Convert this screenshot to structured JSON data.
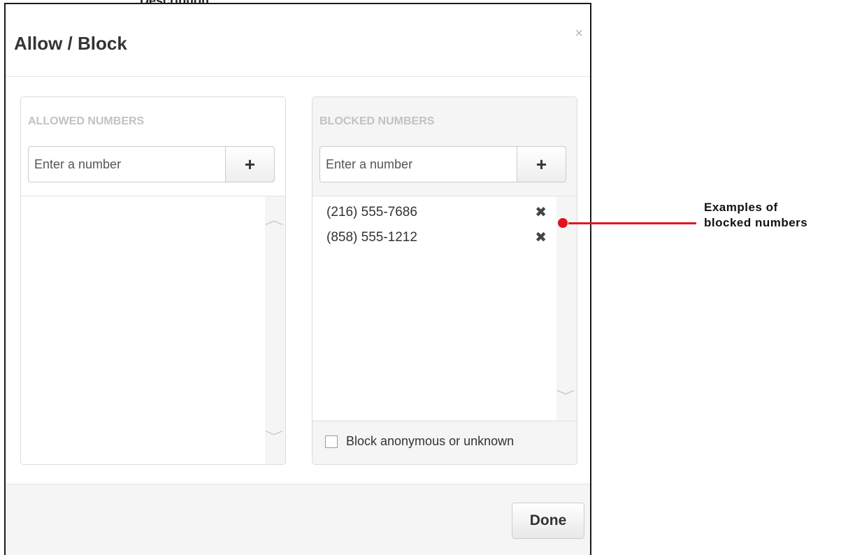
{
  "background": {
    "partial_text": "Description"
  },
  "dialog": {
    "title": "Allow / Block",
    "close_symbol": "×",
    "done_label": "Done"
  },
  "allowed": {
    "heading": "ALLOWED NUMBERS",
    "input_placeholder": "Enter a number",
    "add_symbol": "+",
    "numbers": []
  },
  "blocked": {
    "heading": "BLOCKED NUMBERS",
    "input_placeholder": "Enter a number",
    "add_symbol": "+",
    "numbers": [
      "(216) 555-7686",
      "(858) 555-1212"
    ],
    "remove_symbol": "✖",
    "anonymous_checkbox_label": "Block anonymous or unknown",
    "anonymous_checked": false
  },
  "scroll": {
    "up_symbol": "︿",
    "down_symbol": "﹀"
  },
  "annotation": {
    "line1": "Examples of",
    "line2": "blocked numbers",
    "color": "#e3141e"
  }
}
